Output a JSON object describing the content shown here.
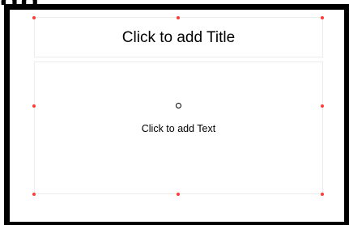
{
  "slide": {
    "title_placeholder": "Click to add Title",
    "text_placeholder": "Click to add Text"
  },
  "colors": {
    "frame": "#000000",
    "selection_handle": "#ff3b3b",
    "placeholder_border": "#ececec"
  },
  "icons": {
    "rotate_handle": "rotation-point-icon"
  }
}
